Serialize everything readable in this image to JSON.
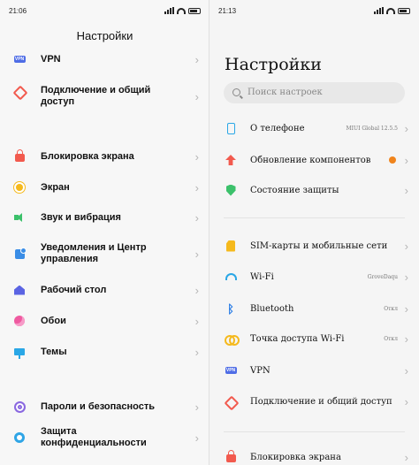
{
  "left": {
    "status": {
      "time": "21:06"
    },
    "title": "Настройки",
    "items": [
      {
        "label": "VPN"
      },
      {
        "label": "Подключение и общий доступ"
      },
      {
        "label": "Блокировка экрана"
      },
      {
        "label": "Экран"
      },
      {
        "label": "Звук и вибрация"
      },
      {
        "label": "Уведомления и Центр управления"
      },
      {
        "label": "Рабочий стол"
      },
      {
        "label": "Обои"
      },
      {
        "label": "Темы"
      },
      {
        "label": "Пароли и безопасность"
      },
      {
        "label": "Защита конфиденциальности"
      }
    ]
  },
  "right": {
    "status": {
      "time": "21:13"
    },
    "title": "Настройки",
    "search": {
      "placeholder": "Поиск настроек"
    },
    "items": [
      {
        "label": "О телефоне",
        "value": "MIUI Global 12.5.5"
      },
      {
        "label": "Обновление компонентов"
      },
      {
        "label": "Состояние защиты"
      },
      {
        "label": "SIM-карты и мобильные сети"
      },
      {
        "label": "Wi-Fi",
        "value": "GroveDaqu"
      },
      {
        "label": "Bluetooth",
        "value": "Откл"
      },
      {
        "label": "Точка доступа Wi-Fi",
        "value": "Откл"
      },
      {
        "label": "VPN"
      },
      {
        "label": "Подключение и общий доступ"
      },
      {
        "label": "Блокировка экрана"
      }
    ]
  },
  "icons": {
    "chevron": "›",
    "vpn_badge": "VPN",
    "bluetooth": "ᛒ"
  },
  "colors": {
    "accent_orange": "#f0841c",
    "chevron": "#b5b5b5"
  }
}
